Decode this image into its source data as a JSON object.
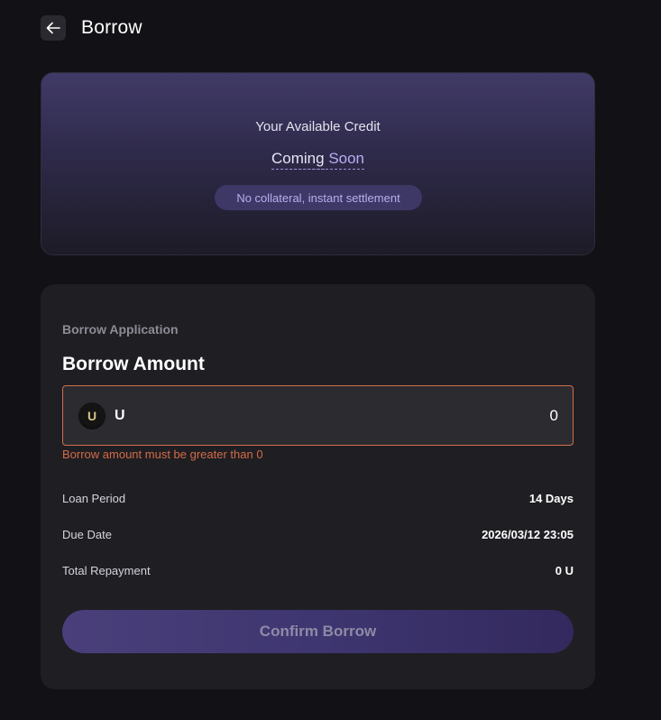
{
  "header": {
    "title": "Borrow",
    "back_icon": "arrow-left-icon"
  },
  "credit": {
    "label": "Your Available Credit",
    "value_part1": "Coming",
    "value_part2": "Soon",
    "badge": "No collateral, instant settlement"
  },
  "borrow": {
    "section_label": "Borrow Application",
    "amount_title": "Borrow Amount",
    "token": {
      "icon_letter": "U",
      "symbol": "U"
    },
    "amount_value": "0",
    "error": "Borrow amount must be greater than 0",
    "rows": [
      {
        "label": "Loan Period",
        "value": "14 Days"
      },
      {
        "label": "Due Date",
        "value": "2026/03/12 23:05"
      },
      {
        "label": "Total Repayment",
        "value": "0 U"
      }
    ],
    "confirm_label": "Confirm Borrow"
  },
  "colors": {
    "background": "#121115",
    "card": "#1f1e23",
    "accent": "#b9aef3",
    "error": "#d26b47"
  }
}
